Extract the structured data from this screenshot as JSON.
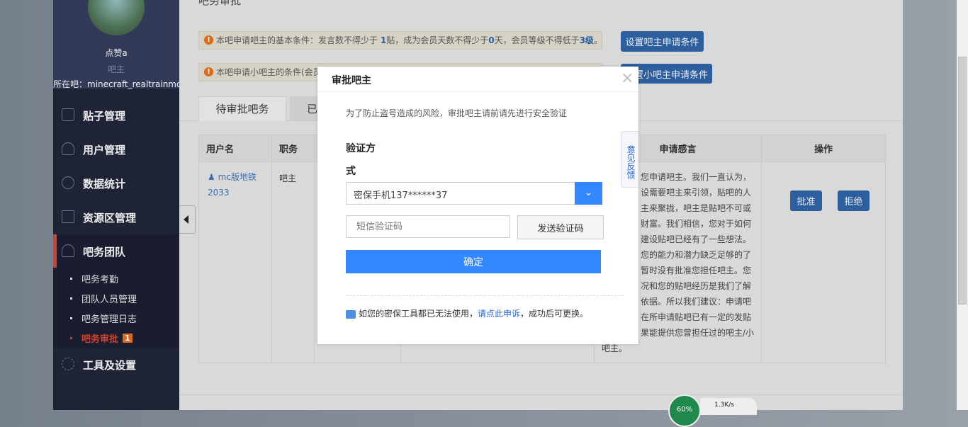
{
  "page_title": "吧务审批",
  "profile": {
    "name": "点赞a",
    "role": "吧主",
    "forum_label": "所在吧：",
    "forum_name": "minecraft_realtrainmod"
  },
  "nav": [
    {
      "label": "贴子管理",
      "icon": "document-icon"
    },
    {
      "label": "用户管理",
      "icon": "user-icon"
    },
    {
      "label": "数据统计",
      "icon": "pie-chart-icon"
    },
    {
      "label": "资源区管理",
      "icon": "folder-icon"
    },
    {
      "label": "吧务团队",
      "icon": "team-icon"
    },
    {
      "label": "工具及设置",
      "icon": "gear-icon"
    }
  ],
  "subnav": [
    {
      "label": "吧务考勤"
    },
    {
      "label": "团队人员管理"
    },
    {
      "label": "吧务管理日志"
    },
    {
      "label": "吧务审批",
      "badge": "1"
    }
  ],
  "notices": [
    {
      "parts": [
        "本吧申请吧主的基本条件：发言数不得少于 ",
        "1",
        "贴，成为会员天数不得少于",
        "0",
        "天，会员等级不得低于",
        "3级",
        "。"
      ],
      "button": "设置吧主申请条件"
    },
    {
      "text": "本吧申请小吧主的条件(会员",
      "button": "设置小吧主申请条件"
    }
  ],
  "tabs": [
    {
      "label": "待审批吧务",
      "active": true
    },
    {
      "label": "已"
    }
  ],
  "table": {
    "headers": [
      "用户名",
      "职务",
      "",
      "",
      "申请感言",
      "操作"
    ],
    "rows": [
      {
        "user": "mc版地铁2033",
        "role": "吧主",
        "message_lines": [
          "您申请吧主。我们一直认为，",
          "设需要吧主来引领，贴吧的人",
          "主来聚拢，吧主是贴吧不可或",
          "财富。我们相信，您对于如何",
          "建设贴吧已经有了一些想法。",
          "您的能力和潜力缺乏足够的了",
          "暂时没有批准您担任吧主。您",
          "况和您的贴吧经历是我们了解",
          "依据。所以我们建议：申请吧",
          "在所申请贴吧已有一定的发贴",
          "果能提供您曾担任过的吧主/小",
          "吧主。"
        ],
        "approve": "批准",
        "reject": "拒绝"
      }
    ]
  },
  "modal": {
    "title": "审批吧主",
    "intro": "为了防止盗号造成的风险，审批吧主请前请先进行安全验证",
    "method_label_1": "验证方",
    "method_label_2": "式",
    "method_value": "密保手机137******37",
    "code_placeholder": "短信验证码",
    "send_button": "发送验证码",
    "confirm_button": "确定",
    "footer_pre": "如您的密保工具都已无法使用，",
    "footer_link": "请点此申诉",
    "footer_post": "，成功后可更换。"
  },
  "feedback": "意见反馈",
  "widget": {
    "percent": "60%",
    "speed": "1.3K/s"
  },
  "colors": {
    "accent": "#3388ff",
    "sidebar": "#1f2336",
    "active_red": "#d2412e"
  }
}
